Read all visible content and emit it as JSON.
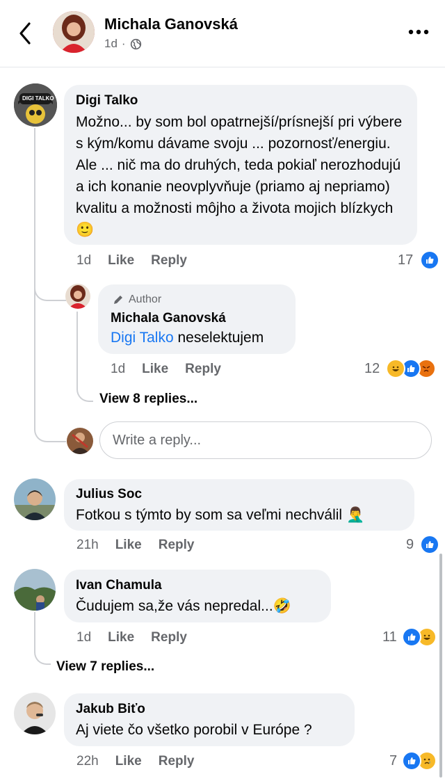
{
  "header": {
    "name": "Michala Ganovská",
    "time": "1d",
    "separator": "·"
  },
  "colors": {
    "accent": "#1877f2",
    "bubble": "#f0f2f5",
    "meta": "#65676b"
  },
  "comments": [
    {
      "author": "Digi Talko",
      "avatar_text": "DIGI TALKO",
      "text": "Možno... by som bol opatrnejší/prísnejší pri výbere s kým/komu dávame svoju ... pozornosť/energiu. Ale ... nič ma do druhých, teda pokiaľ nerozhodujú a ich konanie neovplyvňuje (priamo aj nepriamo) kvalitu a možnosti môjho a života mojich blízkych",
      "emoji": "🙂",
      "time": "1d",
      "like": "Like",
      "reply": "Reply",
      "count": "17",
      "reactions": [
        "like"
      ]
    },
    {
      "author_badge": "Author",
      "author": "Michala Ganovská",
      "mention": "Digi Talko",
      "text": "neselektujem",
      "time": "1d",
      "like": "Like",
      "reply": "Reply",
      "count": "12",
      "reactions": [
        "haha",
        "like",
        "angry"
      ]
    },
    {
      "author": "Julius Soc",
      "text": "Fotkou s týmto by som sa veľmi nechválil",
      "emoji": "🤦‍♂️",
      "time": "21h",
      "like": "Like",
      "reply": "Reply",
      "count": "9",
      "reactions": [
        "like"
      ]
    },
    {
      "author": "Ivan Chamula",
      "text": "Čudujem sa,že vás nepredal...",
      "emoji": "🤣",
      "time": "1d",
      "like": "Like",
      "reply": "Reply",
      "count": "11",
      "reactions": [
        "like",
        "haha"
      ]
    },
    {
      "author": "Jakub Biťo",
      "text": "Aj viete čo všetko porobil v Európe ?",
      "time": "22h",
      "like": "Like",
      "reply": "Reply",
      "count": "7",
      "reactions": [
        "like",
        "sad"
      ]
    }
  ],
  "view_replies_1": "View 8 replies...",
  "view_replies_2": "View 7 replies...",
  "reply_input": {
    "placeholder": "Write a reply..."
  },
  "icons": {
    "back": "back-arrow-icon",
    "more": "more-dots-icon",
    "globe": "globe-icon",
    "pencil": "pencil-icon"
  }
}
